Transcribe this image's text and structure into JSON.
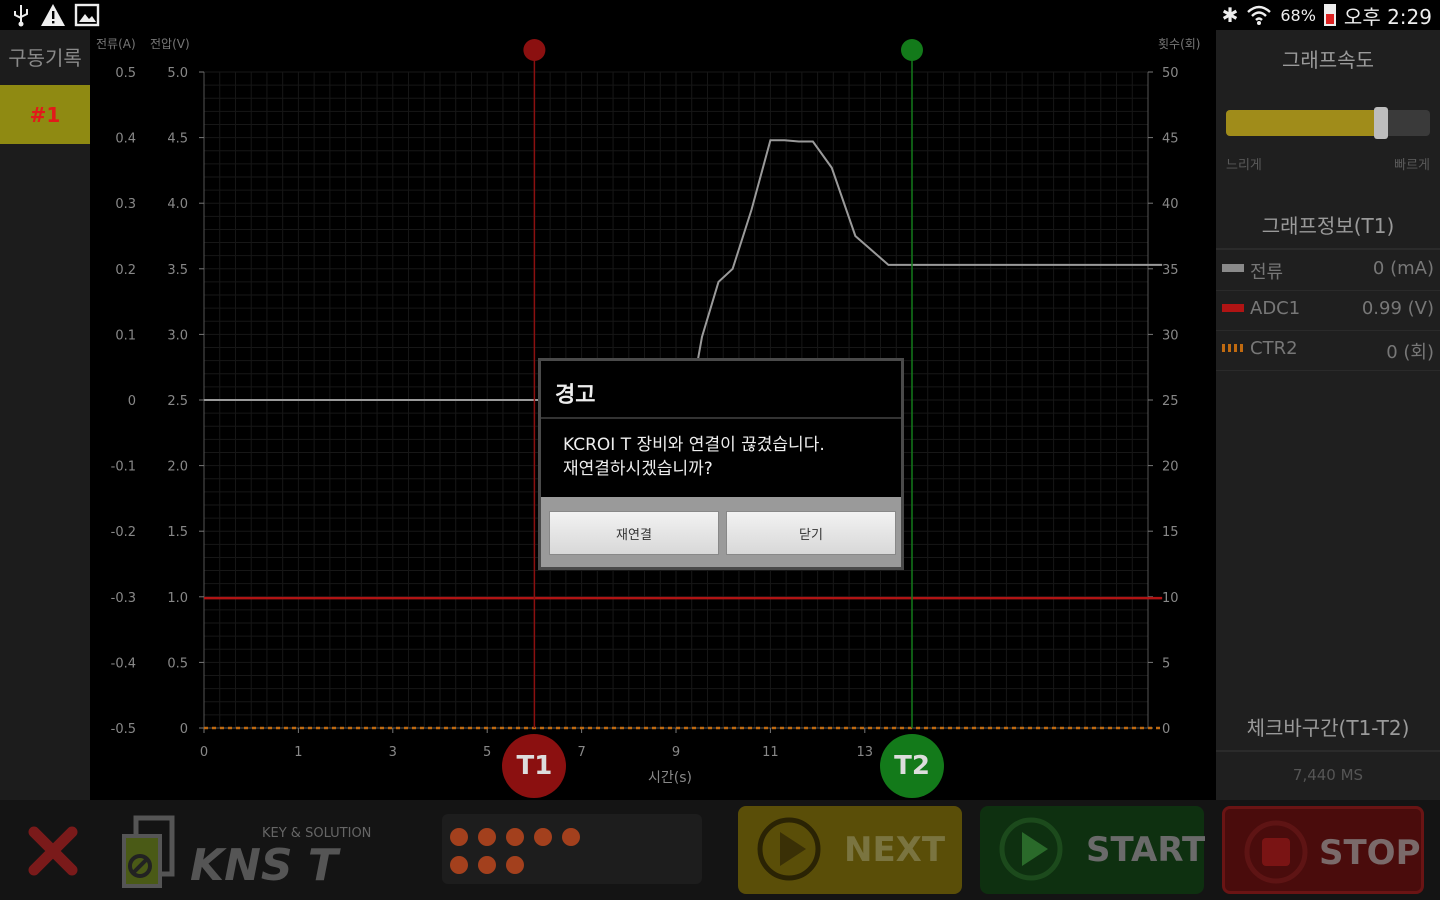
{
  "statusbar": {
    "battery": "68%",
    "time": "오후 2:29"
  },
  "left": {
    "title": "구동기록",
    "record_tab": "#1"
  },
  "chart_data": {
    "type": "line",
    "left_axis_labels": [
      "전류(A)",
      "전압(V)"
    ],
    "right_axis_label": "횟수(회)",
    "xlabel": "시간(s)",
    "current_ticks": [
      "0.5",
      "0.4",
      "0.3",
      "0.2",
      "0.1",
      "0",
      "-0.1",
      "-0.2",
      "-0.3",
      "-0.4",
      "-0.5"
    ],
    "voltage_ticks": [
      "5.0",
      "4.5",
      "4.0",
      "3.5",
      "3.0",
      "2.5",
      "2.0",
      "1.5",
      "1.0",
      "0.5",
      "0"
    ],
    "count_ticks": [
      "50",
      "45",
      "40",
      "35",
      "30",
      "25",
      "20",
      "15",
      "10",
      "5",
      "0"
    ],
    "x_ticks": [
      "0",
      "1",
      "3",
      "5",
      "7",
      "9",
      "11",
      "13"
    ],
    "xlim": [
      0,
      20
    ],
    "voltage_ylim": [
      0,
      5
    ],
    "series": [
      {
        "name": "전류",
        "color": "#9a9a9a",
        "x": [
          0,
          7.1,
          9.9,
          10.2,
          10.4,
          10.55,
          10.9,
          11.2,
          11.6,
          12.0,
          12.3,
          12.6,
          12.9,
          13.3,
          13.8,
          14.5,
          15.5,
          16.5,
          17.5,
          18.6,
          19.4,
          20.3
        ],
        "y": [
          2.5,
          2.5,
          2.5,
          2.55,
          2.68,
          2.98,
          3.4,
          3.5,
          3.95,
          4.48,
          4.48,
          4.47,
          4.47,
          4.27,
          3.75,
          3.53,
          3.53,
          3.53,
          3.53,
          3.53,
          3.53,
          3.53
        ]
      },
      {
        "name": "ADC1",
        "color": "#b01414",
        "x": [
          0,
          20.3
        ],
        "y": [
          0.99,
          0.99
        ]
      },
      {
        "name": "CTR2",
        "color": "#c06a10",
        "x": [
          0,
          20.3
        ],
        "y": [
          0,
          0
        ]
      }
    ],
    "markers": [
      {
        "label": "T1",
        "x": 7.0,
        "color": "#8b1010"
      },
      {
        "label": "T2",
        "x": 15.0,
        "color": "#137a1a"
      }
    ],
    "grid": true
  },
  "right": {
    "speed_title": "그래프속도",
    "slow": "느리게",
    "fast": "빠르게",
    "speed_value": 0.76,
    "info_title": "그래프정보(T1)",
    "rows": [
      {
        "name": "전류",
        "value": "0 (mA)",
        "color": "#8a8a8a"
      },
      {
        "name": "ADC1",
        "value": "0.99 (V)",
        "color": "#b01414"
      },
      {
        "name": "CTR2",
        "value": "0 (회)",
        "color": "#c06a10"
      }
    ],
    "range_title": "체크바구간(T1-T2)",
    "range_value": "7,440 MS"
  },
  "dialog": {
    "title": "경고",
    "message_line1": "KCROI T 장비와 연결이 끊겼습니다.",
    "message_line2": "재연결하시겠습니까?",
    "reconnect": "재연결",
    "close": "닫기"
  },
  "bottom": {
    "logo_sub": "KEY & SOLUTION",
    "logo_text": "KNS T",
    "next": "NEXT",
    "start": "START",
    "stop": "STOP"
  }
}
